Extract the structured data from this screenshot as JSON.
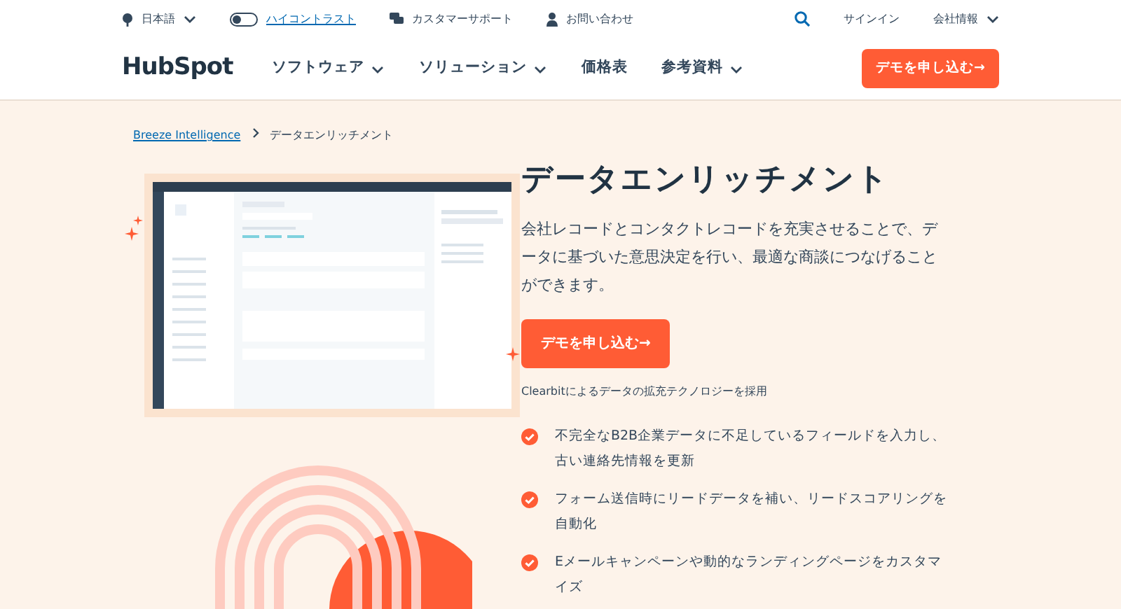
{
  "utility_bar": {
    "language": {
      "label": "日本語"
    },
    "contrast_toggle": {
      "label": "ハイコントラスト",
      "on": false
    },
    "support": "カスタマーサポート",
    "contact": "お問い合わせ",
    "signin": "サインイン",
    "company": "会社情報"
  },
  "nav": {
    "logo": "HubSpot",
    "items": [
      {
        "label": "ソフトウェア",
        "dropdown": true
      },
      {
        "label": "ソリューション",
        "dropdown": true
      },
      {
        "label": "価格表",
        "dropdown": false
      },
      {
        "label": "参考資料",
        "dropdown": true
      }
    ],
    "cta": "デモを申し込む→"
  },
  "breadcrumb": [
    {
      "label": "Breeze Intelligence",
      "link": true
    },
    {
      "label": "データエンリッチメント",
      "link": false
    }
  ],
  "hero": {
    "title": "データエンリッチメント",
    "description": "会社レコードとコンタクトレコードを充実させることで、データに基づいた意思決定を行い、最適な商談につなげることができます。",
    "cta": "デモを申し込む→",
    "note": "Clearbitによるデータの拡充テクノロジーを採用",
    "features": [
      "不完全なB2B企業データに不足しているフィールドを入力し、古い連絡先情報を更新",
      "フォーム送信時にリードデータを補い、リードスコアリングを自動化",
      "Eメールキャンペーンや動的なランディングページをカスタマイズ"
    ]
  }
}
